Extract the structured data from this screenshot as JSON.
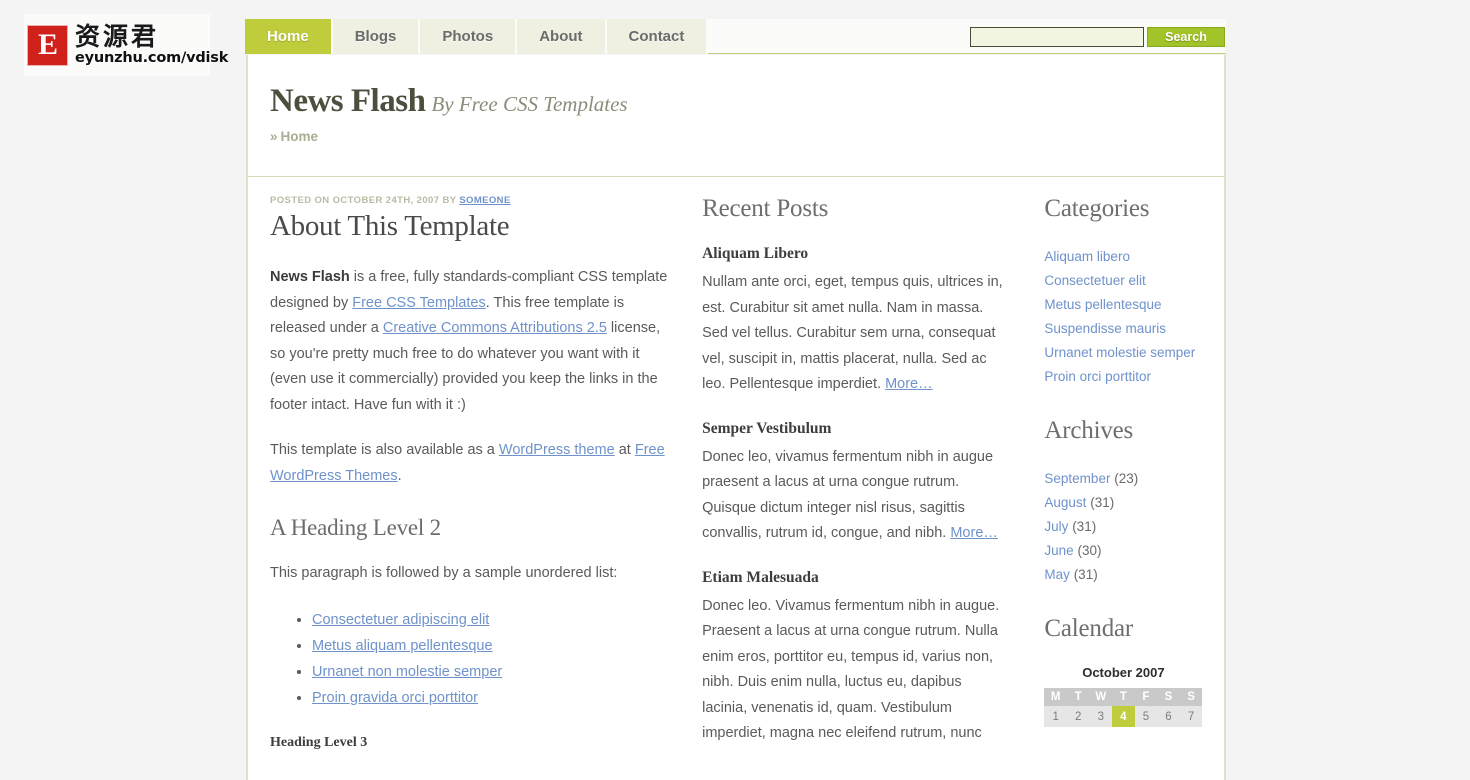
{
  "brand": {
    "mark_letter": "E",
    "chinese_name": "资源君",
    "url": "eyunzhu.com/vdisk"
  },
  "nav": {
    "items": [
      {
        "label": "Home",
        "active": true
      },
      {
        "label": "Blogs",
        "active": false
      },
      {
        "label": "Photos",
        "active": false
      },
      {
        "label": "About",
        "active": false
      },
      {
        "label": "Contact",
        "active": false
      }
    ]
  },
  "search": {
    "value": "",
    "placeholder": "",
    "button_label": "Search"
  },
  "header": {
    "title": "News Flash",
    "tagline": "By Free CSS Templates",
    "breadcrumb_sep": "»",
    "breadcrumb_label": "Home"
  },
  "post": {
    "meta_prefix": "POSTED ON OCTOBER 24TH, 2007 BY ",
    "meta_author": "SOMEONE",
    "title": "About This Template",
    "p1": {
      "strong": "News Flash",
      "t1": " is a free, fully standards-compliant CSS template designed by ",
      "link1": "Free CSS Templates",
      "t2": ". This free template is released under a ",
      "link2": "Creative Commons Attributions 2.5",
      "t3": " license, so you're pretty much free to do whatever you want with it (even use it commercially) provided you keep the links in the footer intact. Have fun with it :)"
    },
    "p2": {
      "t1": "This template is also available as a ",
      "link1": "WordPress theme",
      "t2": " at ",
      "link2": "Free WordPress Themes",
      "t3": "."
    },
    "heading2": "A Heading Level 2",
    "p3": "This paragraph is followed by a sample unordered list:",
    "list": [
      "Consectetuer adipiscing elit",
      "Metus aliquam pellentesque",
      "Urnanet non molestie semper",
      "Proin gravida orci porttitor"
    ],
    "heading3": "Heading Level 3"
  },
  "recent": {
    "heading": "Recent Posts",
    "more_label": "More…",
    "items": [
      {
        "title": "Aliquam Libero",
        "body": "Nullam ante orci, eget, tempus quis, ultrices in, est. Curabitur sit amet nulla. Nam in massa. Sed vel tellus. Curabitur sem urna, consequat vel, suscipit in, mattis placerat, nulla. Sed ac leo. Pellentesque imperdiet. "
      },
      {
        "title": "Semper Vestibulum",
        "body": "Donec leo, vivamus fermentum nibh in augue praesent a lacus at urna congue rutrum. Quisque dictum integer nisl risus, sagittis convallis, rutrum id, congue, and nibh. "
      },
      {
        "title": "Etiam Malesuada",
        "body": "Donec leo. Vivamus fermentum nibh in augue. Praesent a lacus at urna congue rutrum. Nulla enim eros, porttitor eu, tempus id, varius non, nibh. Duis enim nulla, luctus eu, dapibus lacinia, venenatis id, quam. Vestibulum imperdiet, magna nec eleifend rutrum, nunc"
      }
    ]
  },
  "sidebar": {
    "categories_heading": "Categories",
    "categories": [
      "Aliquam libero",
      "Consectetuer elit",
      "Metus pellentesque",
      "Suspendisse mauris",
      "Urnanet molestie semper",
      "Proin orci porttitor"
    ],
    "archives_heading": "Archives",
    "archives": [
      {
        "label": "September",
        "count": "(23)"
      },
      {
        "label": "August",
        "count": "(31)"
      },
      {
        "label": "July",
        "count": "(31)"
      },
      {
        "label": "June",
        "count": "(30)"
      },
      {
        "label": "May",
        "count": "(31)"
      }
    ],
    "calendar_heading": "Calendar"
  },
  "calendar": {
    "caption": "October 2007",
    "weekdays": [
      "M",
      "T",
      "W",
      "T",
      "F",
      "S",
      "S"
    ],
    "week1": [
      "1",
      "2",
      "3",
      "4",
      "5",
      "6",
      "7"
    ],
    "today": "4"
  },
  "colors": {
    "accent_green": "#bfcd3c",
    "search_button": "#a3c429",
    "link_blue": "#6f92cb",
    "page_bg": "#f4f4f4",
    "border_khaki": "#dfe0c4"
  }
}
